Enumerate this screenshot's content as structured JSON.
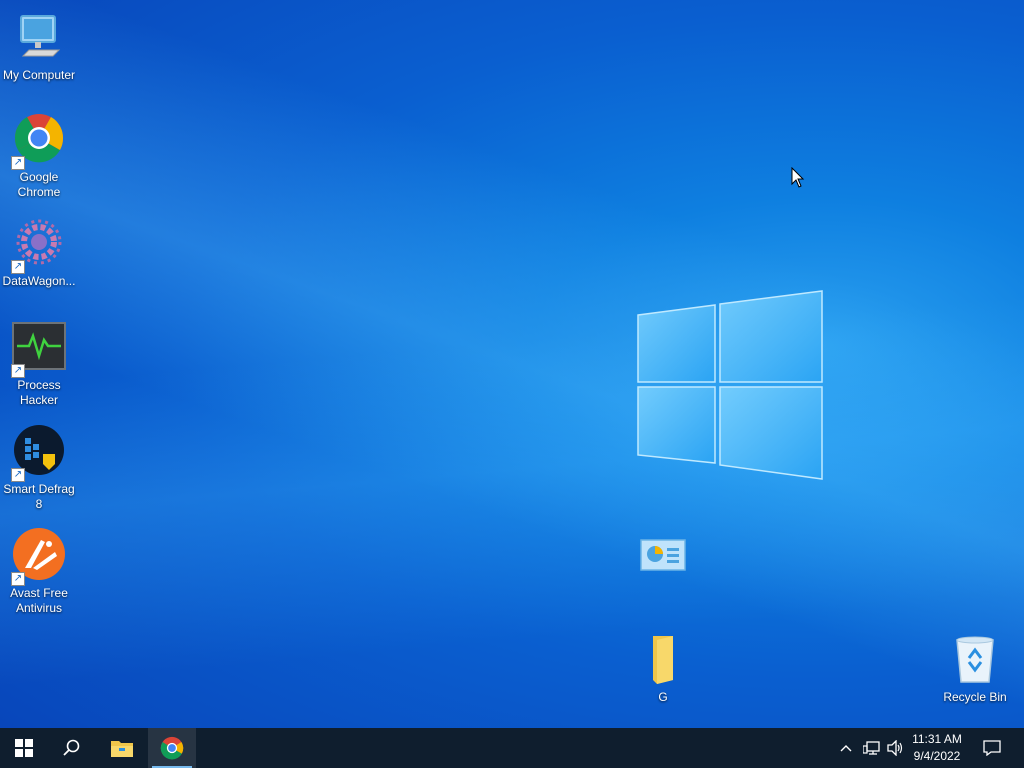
{
  "desktop": {
    "icons": [
      {
        "label": "My Computer",
        "icon": "computer-icon"
      },
      {
        "label": "Google Chrome",
        "icon": "chrome-icon"
      },
      {
        "label": "DataWagon...",
        "icon": "datawagon-icon"
      },
      {
        "label": "Process Hacker",
        "icon": "process-hacker-icon"
      },
      {
        "label": "Smart Defrag 8",
        "icon": "smart-defrag-icon"
      },
      {
        "label": "Avast Free Antivirus",
        "icon": "avast-icon"
      },
      {
        "label": "",
        "icon": "control-panel-icon"
      },
      {
        "label": "G",
        "icon": "folder-icon"
      },
      {
        "label": "Recycle Bin",
        "icon": "recycle-bin-icon"
      }
    ]
  },
  "taskbar": {
    "start": "start-icon",
    "search": "search-icon",
    "apps": [
      "file-explorer-icon",
      "chrome-icon"
    ],
    "tray": [
      "chevron-up-icon",
      "network-icon",
      "volume-icon"
    ],
    "time": "11:31 AM",
    "date": "9/4/2022",
    "notification": "notification-icon"
  },
  "colors": {
    "taskbar": "#0f1e2e",
    "accent": "#76b9ed",
    "wallpaper": "#0a5fd0"
  }
}
